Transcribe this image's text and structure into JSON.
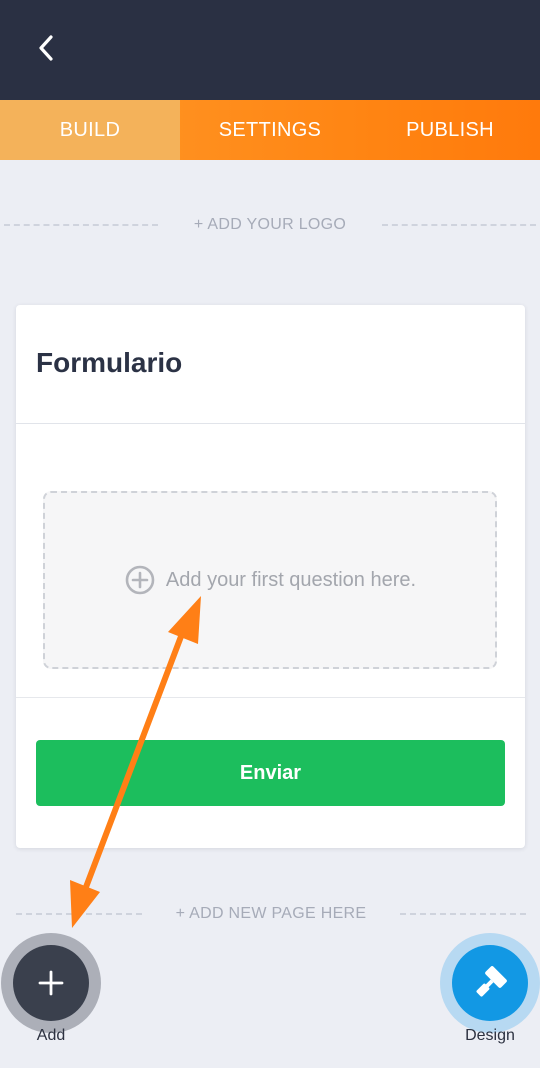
{
  "header": {
    "back_icon": "chevron-left-icon"
  },
  "tabs": [
    {
      "label": "BUILD",
      "active": true
    },
    {
      "label": "SETTINGS",
      "active": false
    },
    {
      "label": "PUBLISH",
      "active": false
    }
  ],
  "logo_prompt": "+ ADD YOUR LOGO",
  "form": {
    "title": "Formulario",
    "question_placeholder": "Add your first question here.",
    "question_icon": "plus-circle-icon",
    "submit_label": "Enviar"
  },
  "add_page_prompt": "+ ADD NEW PAGE HERE",
  "fabs": {
    "add_label": "Add",
    "add_icon": "plus-icon",
    "design_label": "Design",
    "design_icon": "paint-roller-icon"
  },
  "colors": {
    "header_bg": "#2a3043",
    "tab_bar": "#ff8412",
    "tab_active": "#f4b25a",
    "submit": "#1cbe5d",
    "design_fab": "#1298e4",
    "annotation_arrow": "#ff7f16"
  }
}
